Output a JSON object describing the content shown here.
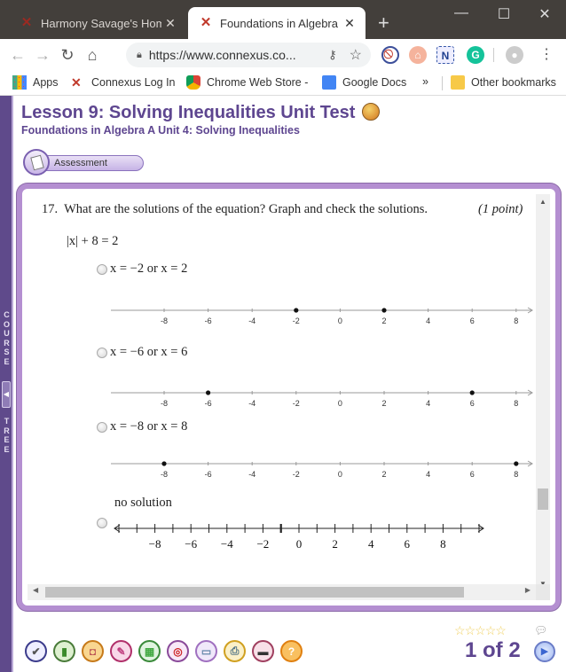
{
  "browser": {
    "tabs": [
      {
        "title": "Harmony Savage's Home",
        "active": false
      },
      {
        "title": "Foundations in Algebra A",
        "active": true
      }
    ],
    "new_tab_label": "+",
    "url": "https://www.connexus.co...",
    "bookmarks": [
      {
        "label": "Apps",
        "icon": "apps-grid-icon"
      },
      {
        "label": "Connexus Log In",
        "icon": "connexus-icon"
      },
      {
        "label": "Chrome Web Store -",
        "icon": "web-store-icon"
      },
      {
        "label": "Google Docs",
        "icon": "docs-icon"
      },
      {
        "label": "»",
        "icon": "overflow-icon"
      },
      {
        "label": "Other bookmarks",
        "icon": "folder-icon"
      }
    ]
  },
  "course_tree": {
    "top": "COURSE",
    "bottom": "TREE"
  },
  "lesson": {
    "title": "Lesson 9: Solving Inequalities Unit Test",
    "subtitle": "Foundations in Algebra A  Unit 4: Solving Inequalities",
    "badge": "Assessment"
  },
  "question": {
    "number": "17.",
    "prompt": "What are the solutions of the equation? Graph and check the solutions.",
    "points": "(1 point)",
    "equation": "|x| + 8 = 2",
    "options": [
      {
        "label": "x = −2 or x = 2",
        "points": [
          -2,
          2
        ]
      },
      {
        "label": "x = −6 or x = 6",
        "points": [
          -6,
          6
        ]
      },
      {
        "label": "x = −8 or x = 8",
        "points": [
          -8,
          8
        ]
      },
      {
        "label": "no solution",
        "points": []
      }
    ],
    "axis_labels": [
      "-8",
      "-6",
      "-4",
      "-2",
      "0",
      "2",
      "4",
      "6",
      "8"
    ],
    "axis_labels_serif": [
      "−8",
      "−6",
      "−4",
      "−2",
      "0",
      "2",
      "4",
      "6",
      "8"
    ]
  },
  "footer": {
    "tools": [
      "check-icon",
      "book-icon",
      "backpack-icon",
      "pin-icon",
      "calculator-icon",
      "target-icon",
      "monitor-icon",
      "printer-icon",
      "tools-icon",
      "help-icon"
    ],
    "rating_stars": 5,
    "rating_value": 0,
    "pager": "1 of 2"
  }
}
